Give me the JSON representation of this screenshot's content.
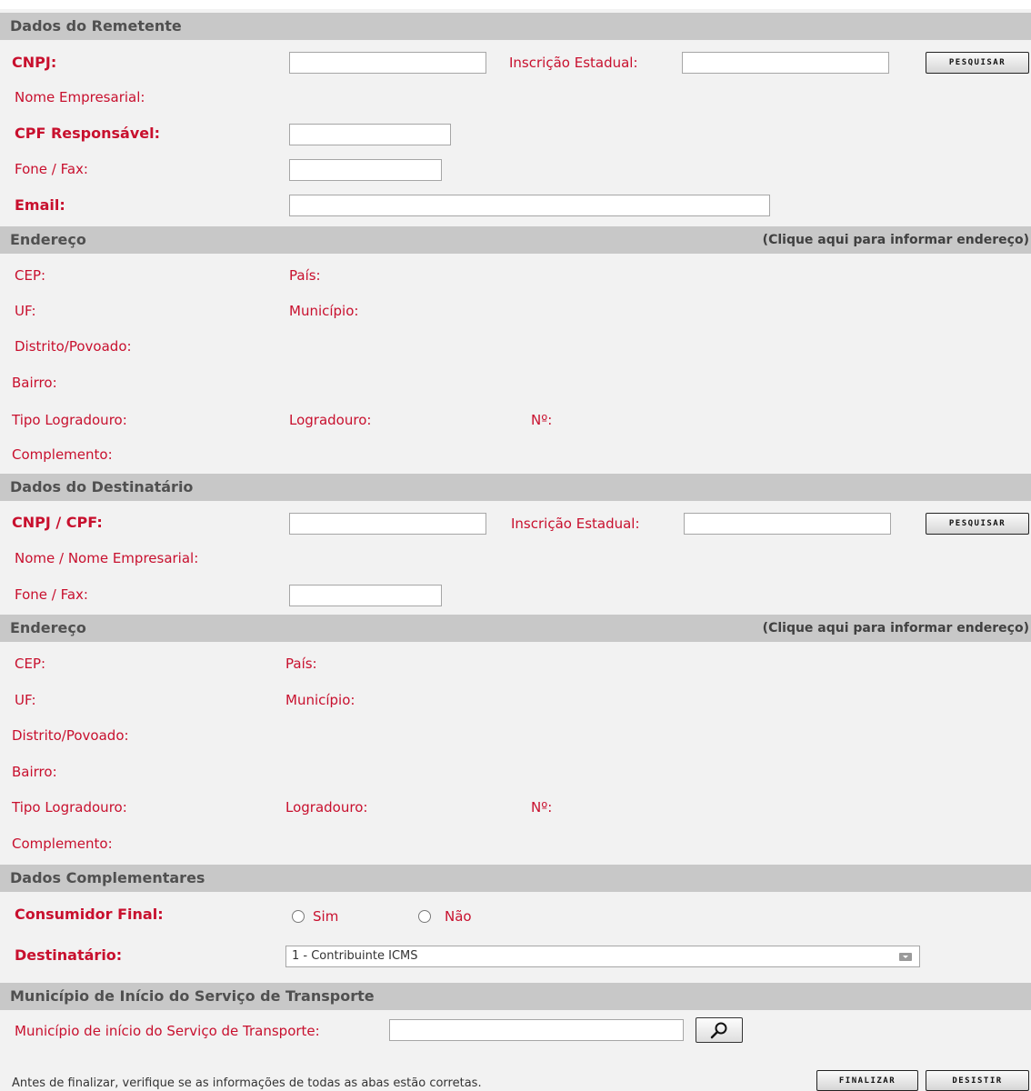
{
  "remetente": {
    "header": "Dados do Remetente",
    "cnpj_label": "CNPJ:",
    "ie_label": "Inscrição Estadual:",
    "search_button": "PESQUISAR",
    "nome_label": "Nome Empresarial:",
    "cpf_label": "CPF Responsável:",
    "fone_label": "Fone / Fax:",
    "email_label": "Email:",
    "cnpj_value": "",
    "ie_value": "",
    "cpf_value": "",
    "fone_value": "",
    "email_value": ""
  },
  "remetente_endereco": {
    "header": "Endereço",
    "link": "(Clique aqui para informar endereço)",
    "cep_label": "CEP:",
    "pais_label": "País:",
    "uf_label": "UF:",
    "municipio_label": "Município:",
    "distrito_label": "Distrito/Povoado:",
    "bairro_label": "Bairro:",
    "tipo_logradouro_label": "Tipo Logradouro:",
    "logradouro_label": "Logradouro:",
    "numero_label": "Nº:",
    "complemento_label": "Complemento:"
  },
  "destinatario": {
    "header": "Dados do Destinatário",
    "cnpj_cpf_label": "CNPJ / CPF:",
    "ie_label": "Inscrição Estadual:",
    "search_button": "PESQUISAR",
    "nome_label": "Nome / Nome Empresarial:",
    "fone_label": "Fone / Fax:",
    "cnpj_cpf_value": "",
    "ie_value": "",
    "fone_value": ""
  },
  "destinatario_endereco": {
    "header": "Endereço",
    "link": "(Clique aqui para informar endereço)",
    "cep_label": "CEP:",
    "pais_label": "País:",
    "uf_label": "UF:",
    "municipio_label": "Município:",
    "distrito_label": "Distrito/Povoado:",
    "bairro_label": "Bairro:",
    "tipo_logradouro_label": "Tipo Logradouro:",
    "logradouro_label": "Logradouro:",
    "numero_label": "Nº:",
    "complemento_label": "Complemento:"
  },
  "complementares": {
    "header": "Dados Complementares",
    "consumidor_label": "Consumidor Final:",
    "radio_sim": "Sim",
    "radio_nao": "Não",
    "destinatario_label": "Destinatário:",
    "destinatario_selected": "1 - Contribuinte ICMS"
  },
  "municipio_inicio": {
    "header": "Município de Início do Serviço de Transporte",
    "label": "Município de início do Serviço de Transporte:",
    "value": "",
    "search_icon": "magnifier-icon"
  },
  "footer": {
    "note": "Antes de finalizar, verifique se as informações de todas as abas estão corretas.",
    "finalizar_button": "FINALIZAR",
    "desistir_button": "DESISTIR"
  },
  "colors": {
    "label_red": "#c8102e",
    "section_bg": "#c8c8c8",
    "page_bg": "#f2f2f2"
  }
}
